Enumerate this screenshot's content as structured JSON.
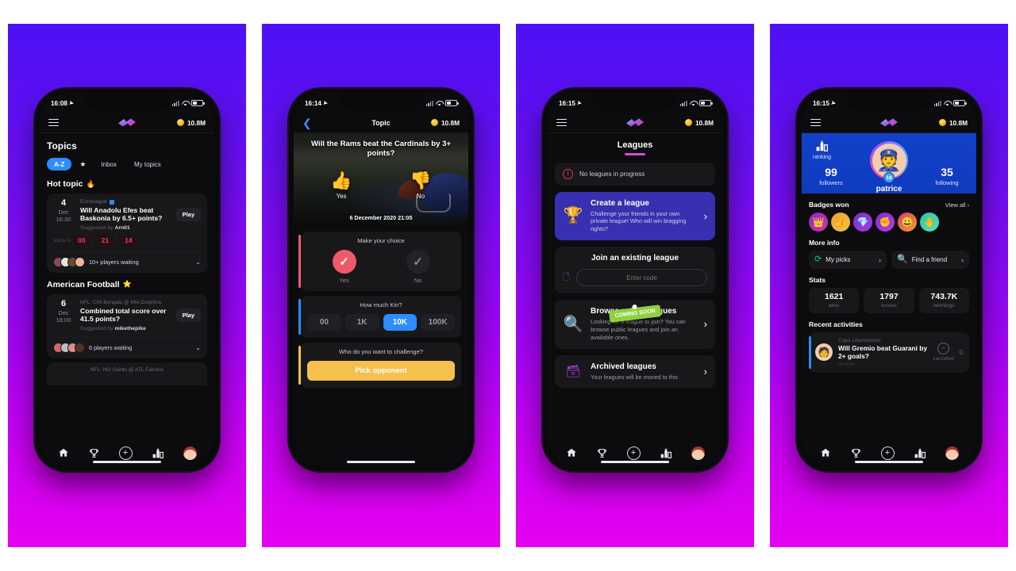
{
  "app": {
    "logo_name": "kin-lightning-logo",
    "coin_balance": "10.8M"
  },
  "panels": [
    {
      "id": "topics",
      "status": {
        "time": "16:08",
        "location_icon": "location-arrow-icon"
      },
      "header": {
        "menu": "hamburger-icon",
        "coin": "10.8M"
      },
      "page_title": "Topics",
      "tabs": [
        {
          "label": "A-Z",
          "active": true
        },
        {
          "label": "★",
          "active": false
        },
        {
          "label": "Inbox",
          "active": false
        },
        {
          "label": "My topics",
          "active": false
        }
      ],
      "sections": [
        {
          "title": "Hot topic",
          "icon": "fire-icon",
          "card": {
            "day": "4",
            "month": "Dec",
            "time": "16:30",
            "league": "Euroleague",
            "verified": true,
            "question": "Will Anadolu Efes beat Baskonia by 6.5+ points?",
            "suggested_label": "Suggested by",
            "suggested_by": "Arn01",
            "play_label": "Play",
            "countdown_label": "starts in",
            "countdown": [
              "00",
              "21",
              "14"
            ],
            "countdown_sep": ":",
            "waiting": "10+ players waiting",
            "avatars": 4
          }
        },
        {
          "title": "American Football",
          "icon": "star-icon",
          "card": {
            "day": "6",
            "month": "Dec",
            "time": "18:00",
            "league": "NFL: CIN Bengals @ MIA Dolphins",
            "verified": false,
            "question": "Combined total score over 41.5 points?",
            "suggested_label": "Suggested by",
            "suggested_by": "mikethepike",
            "play_label": "Play",
            "waiting": "6 players waiting",
            "avatars": 4
          }
        }
      ],
      "peek_card": {
        "league": "NFL: NO Saints @ ATL Falcons"
      }
    },
    {
      "id": "topic-detail",
      "status": {
        "time": "16:14"
      },
      "header": {
        "back": "back-chevron-icon",
        "title": "Topic",
        "coin": "10.8M"
      },
      "hero": {
        "question": "Will the Rams beat the Cardinals by 3+ points?",
        "yes_label": "Yes",
        "no_label": "No",
        "yes_icon": "thumbs-up-icon",
        "no_icon": "thumbs-down-icon",
        "date": "6 December 2020 21:05"
      },
      "steps": [
        {
          "title": "Make your choice",
          "yes_label": "Yes",
          "no_label": "No",
          "selected": "Yes"
        },
        {
          "title": "How much Kin?",
          "amounts": [
            "00",
            "1K",
            "10K",
            "100K"
          ],
          "selected": "10K"
        },
        {
          "title": "Who do you want to challenge?",
          "button": "Pick opponent"
        }
      ]
    },
    {
      "id": "leagues",
      "status": {
        "time": "16:15"
      },
      "header": {
        "menu": "hamburger-icon",
        "coin": "10.8M"
      },
      "page_title": "Leagues",
      "notice": {
        "icon": "alert-circle-icon",
        "text": "No leagues in progress"
      },
      "cards": [
        {
          "kind": "accent",
          "icon": "trophy-icon",
          "title": "Create a league",
          "desc": "Challenge your friends in your own private league! Who will win bragging rights?",
          "chevron": "›"
        },
        {
          "kind": "join",
          "title": "Join an existing league",
          "icon": "paste-code-icon",
          "input_placeholder": "Enter code",
          "input_value": ""
        },
        {
          "kind": "plain",
          "icon": "magnifier-icon",
          "title": "Browse public leagues",
          "desc": "Looking for a league to join? You can browse public leagues and join an available ones.",
          "chevron": "›",
          "ribbon": "COMING SOON"
        },
        {
          "kind": "plain",
          "icon": "archive-icon",
          "title": "Archived leagues",
          "desc": "Your leagues will be moved to this",
          "chevron": "›"
        }
      ]
    },
    {
      "id": "profile",
      "status": {
        "time": "16:15"
      },
      "header": {
        "menu": "hamburger-icon",
        "coin": "10.8M"
      },
      "profile": {
        "ranking_label": "ranking",
        "ranking_icon": "podium-icon",
        "followers_count": "99",
        "followers_label": "followers",
        "following_count": "35",
        "following_label": "following",
        "username": "patrice",
        "level": "18",
        "avatar_icon": "👮"
      },
      "badges_section": {
        "title": "Badges won",
        "view_all": "View all",
        "badges": [
          "crown-badge",
          "thumbs-up-badge",
          "diamond-badge",
          "fist-badge",
          "smiley-badge",
          "hand-badge"
        ]
      },
      "more_info": {
        "title": "More info",
        "items": [
          {
            "icon": "refresh-icon",
            "label": "My picks"
          },
          {
            "icon": "search-icon",
            "label": "Find a friend"
          }
        ]
      },
      "stats": {
        "title": "Stats",
        "items": [
          {
            "value": "1621",
            "label": "wins"
          },
          {
            "value": "1797",
            "label": "losses"
          },
          {
            "value": "743.7K",
            "label": "winnings"
          }
        ]
      },
      "recent": {
        "title": "Recent activities",
        "item": {
          "league": "Copa Libertadores",
          "question": "Will Gremio beat Guarani by 2+ goals?",
          "user": "random",
          "status": "cancelled",
          "status_icon": "minus-circle-icon",
          "amount": "0"
        }
      }
    }
  ],
  "bottom_nav": [
    {
      "icon": "home-icon",
      "label": "Home"
    },
    {
      "icon": "trophy-icon",
      "label": "Leagues"
    },
    {
      "icon": "plus-icon",
      "label": "Create"
    },
    {
      "icon": "podium-icon",
      "label": "Ranking"
    },
    {
      "icon": "avatar-icon",
      "label": "Profile"
    }
  ],
  "colors": {
    "bg_top": "#4d10f5",
    "bg_bottom": "#e600f0",
    "accent_blue": "#2d8cff",
    "accent_red": "#ef5a6a",
    "accent_yellow": "#f5c04e",
    "league_card": "#3730b0",
    "coming_soon": "#8fd13f"
  }
}
